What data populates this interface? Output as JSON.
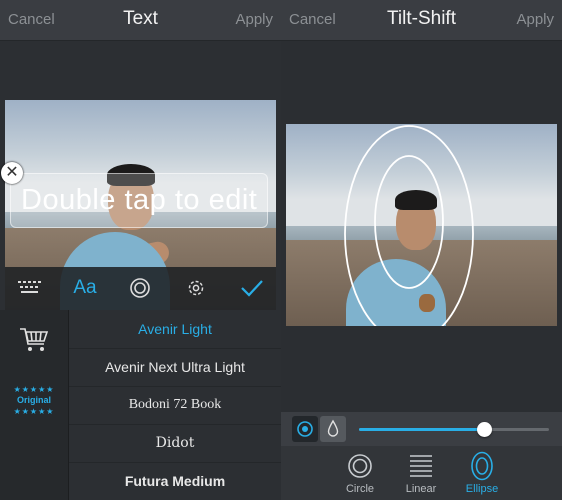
{
  "left": {
    "nav": {
      "cancel": "Cancel",
      "title": "Text",
      "apply": "Apply"
    },
    "overlay_text": "Double tap to edit",
    "toolbar": {
      "font_tool": "Aa"
    },
    "sidebar": {
      "original_badge": "Original",
      "stars": "★★★★★"
    },
    "fonts": [
      {
        "label": "Avenir Light",
        "selected": true
      },
      {
        "label": "Avenir Next Ultra Light",
        "selected": false
      },
      {
        "label": "Bodoni 72 Book",
        "selected": false
      },
      {
        "label": "Didot",
        "selected": false
      },
      {
        "label": "Futura Medium",
        "selected": false
      }
    ]
  },
  "right": {
    "nav": {
      "cancel": "Cancel",
      "title": "Tilt-Shift",
      "apply": "Apply"
    },
    "slider": {
      "value": 0.66
    },
    "modes": [
      {
        "label": "Circle",
        "icon": "circle-mode-icon",
        "active": false
      },
      {
        "label": "Linear",
        "icon": "linear-mode-icon",
        "active": false
      },
      {
        "label": "Ellipse",
        "icon": "ellipse-mode-icon",
        "active": true
      }
    ]
  },
  "colors": {
    "accent": "#29aee6",
    "background": "#2c2f33",
    "navbar": "#3a3d42"
  }
}
